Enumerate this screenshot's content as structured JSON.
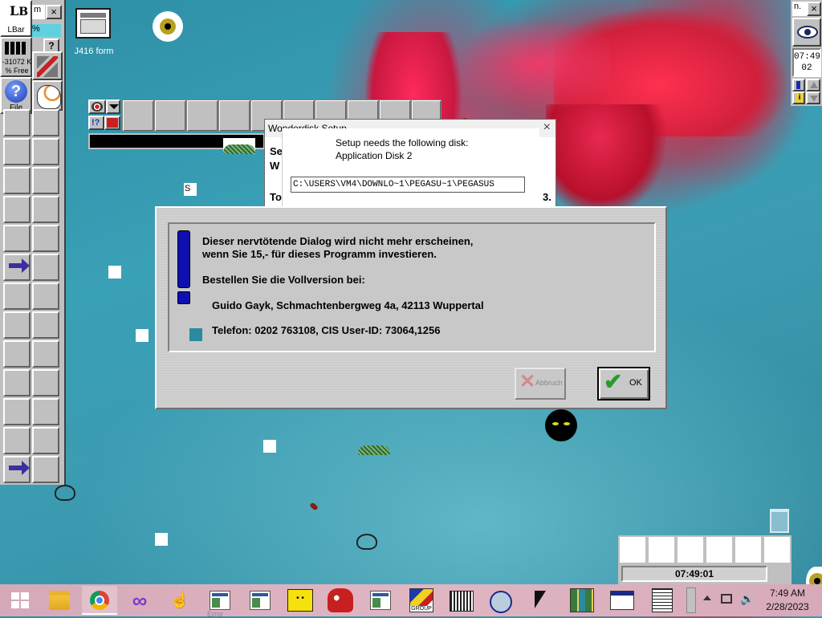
{
  "lbar": {
    "logo": "LBar",
    "memory_value": "-31072 K",
    "memory_unit": "% Free",
    "file_label": "File",
    "sub_window_tab": "m",
    "sub_window_pct": "%",
    "sub_question": "?"
  },
  "desktop": {
    "j416_label": "J416 form",
    "s_label": "S"
  },
  "setup_dialog": {
    "title": "Wonderdisk Setup",
    "message_line1": "Setup needs the following disk:",
    "message_line2": "Application Disk 2",
    "path_value": "C:\\USERS\\VM4\\DOWNLO~1\\PEGASU~1\\PEGASUS",
    "bg_fragments": [
      "Se",
      "W",
      "To",
      "3."
    ]
  },
  "nag_dialog": {
    "line1": "Dieser nervtötende Dialog wird nicht mehr erscheinen,",
    "line2": "wenn Sie 15,-    für dieses Programm investieren.",
    "order_heading": "Bestellen Sie die Vollversion bei:",
    "address": "Guido Gayk, Schmachtenbergweg 4a, 42113 Wuppertal",
    "phone": "Telefon: 0202 763108, CIS User-ID: 73064,1256",
    "cancel_label": "Abbruch",
    "ok_label": "OK"
  },
  "right_panel": {
    "tab_text": "n.",
    "time_hm": "07:49",
    "time_s": "02"
  },
  "clock_bar": {
    "time": "07:49:01"
  },
  "taskbar": {
    "items": [
      {
        "icon": "windows-start-icon"
      },
      {
        "icon": "file-explorer-icon"
      },
      {
        "icon": "chrome-icon"
      },
      {
        "icon": "visual-studio-icon"
      },
      {
        "icon": "cursor-hand-icon"
      },
      {
        "icon": "window-app-icon"
      },
      {
        "icon": "window-app-icon"
      },
      {
        "icon": "yellow-face-icon"
      },
      {
        "icon": "red-creature-icon"
      },
      {
        "icon": "window-app-icon"
      },
      {
        "icon": "group-icon",
        "label": "GROUP"
      },
      {
        "icon": "printer-icon"
      },
      {
        "icon": "disk-icon"
      },
      {
        "icon": "arrow-cursor-icon"
      },
      {
        "icon": "map-icon"
      },
      {
        "icon": "window-cursor-icon"
      },
      {
        "icon": "document-icon"
      }
    ],
    "clock_time": "7:49 AM",
    "clock_date": "2/28/2023",
    "error_ghost": "Error"
  },
  "colors": {
    "desktop_teal": "#3aa0b6",
    "flower_red": "#e02848",
    "taskbar_pink": "#dcb0bf",
    "arrow_purple": "#3a2fa0",
    "ok_green": "#2a9a2a",
    "cancel_red": "#c83232"
  }
}
